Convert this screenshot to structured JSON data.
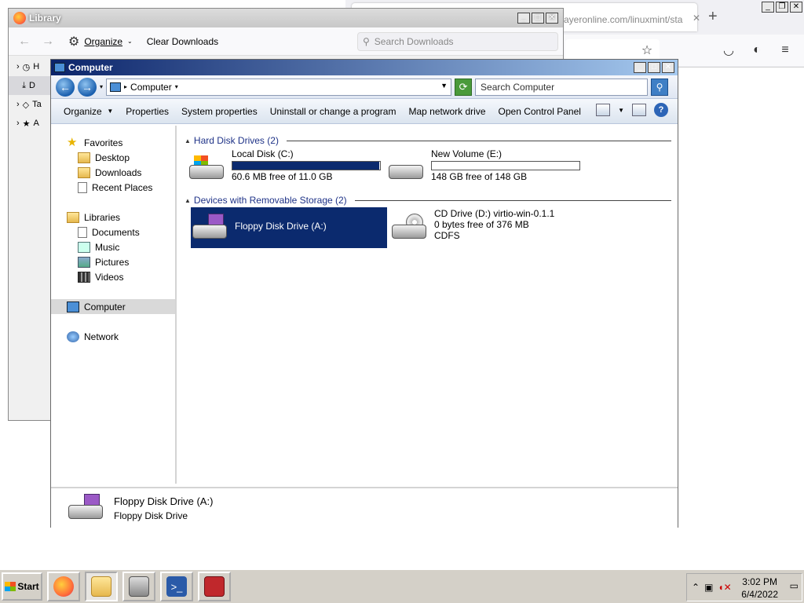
{
  "firefox": {
    "tab_title": "ayeronline.com/linuxmint/sta",
    "tab_close": "✕",
    "new_tab": "+",
    "caps": [
      "_",
      "❐",
      "✕"
    ]
  },
  "library": {
    "title": "Library",
    "organize_label": "Organize",
    "clear_downloads_label": "Clear Downloads",
    "search_placeholder": "Search Downloads",
    "sidebar": [
      "H",
      "D",
      "Ta",
      "A"
    ],
    "caps": [
      "_",
      "□",
      "✕"
    ]
  },
  "explorer": {
    "title": "Computer",
    "caps": [
      "_",
      "□",
      "✕"
    ],
    "address": "Computer",
    "search_placeholder": "Search Computer",
    "commands": [
      "Organize",
      "Properties",
      "System properties",
      "Uninstall or change a program",
      "Map network drive",
      "Open Control Panel"
    ],
    "nav": {
      "favorites": "Favorites",
      "desktop": "Desktop",
      "downloads": "Downloads",
      "recent_places": "Recent Places",
      "libraries": "Libraries",
      "documents": "Documents",
      "music": "Music",
      "pictures": "Pictures",
      "videos": "Videos",
      "computer": "Computer",
      "network": "Network"
    },
    "groups": {
      "hard_disks": "Hard Disk Drives (2)",
      "removable": "Devices with Removable Storage (2)"
    },
    "drives": {
      "c": {
        "name": "Local Disk (C:)",
        "free": "60.6 MB free of 11.0 GB",
        "used_fraction": 0.995
      },
      "e": {
        "name": "New Volume (E:)",
        "free": "148 GB free of 148 GB",
        "used_fraction": 0.0
      },
      "a": {
        "name": "Floppy Disk Drive (A:)"
      },
      "d": {
        "name": "CD Drive (D:) virtio-win-0.1.1",
        "free": "0 bytes free of 376 MB",
        "fs": "CDFS"
      }
    },
    "details": {
      "title": "Floppy Disk Drive (A:)",
      "subtitle": "Floppy Disk Drive"
    }
  },
  "taskbar": {
    "start_label": "Start",
    "time": "3:02 PM",
    "date": "6/4/2022"
  },
  "screen_caps": [
    "_",
    "❐",
    "✕"
  ]
}
